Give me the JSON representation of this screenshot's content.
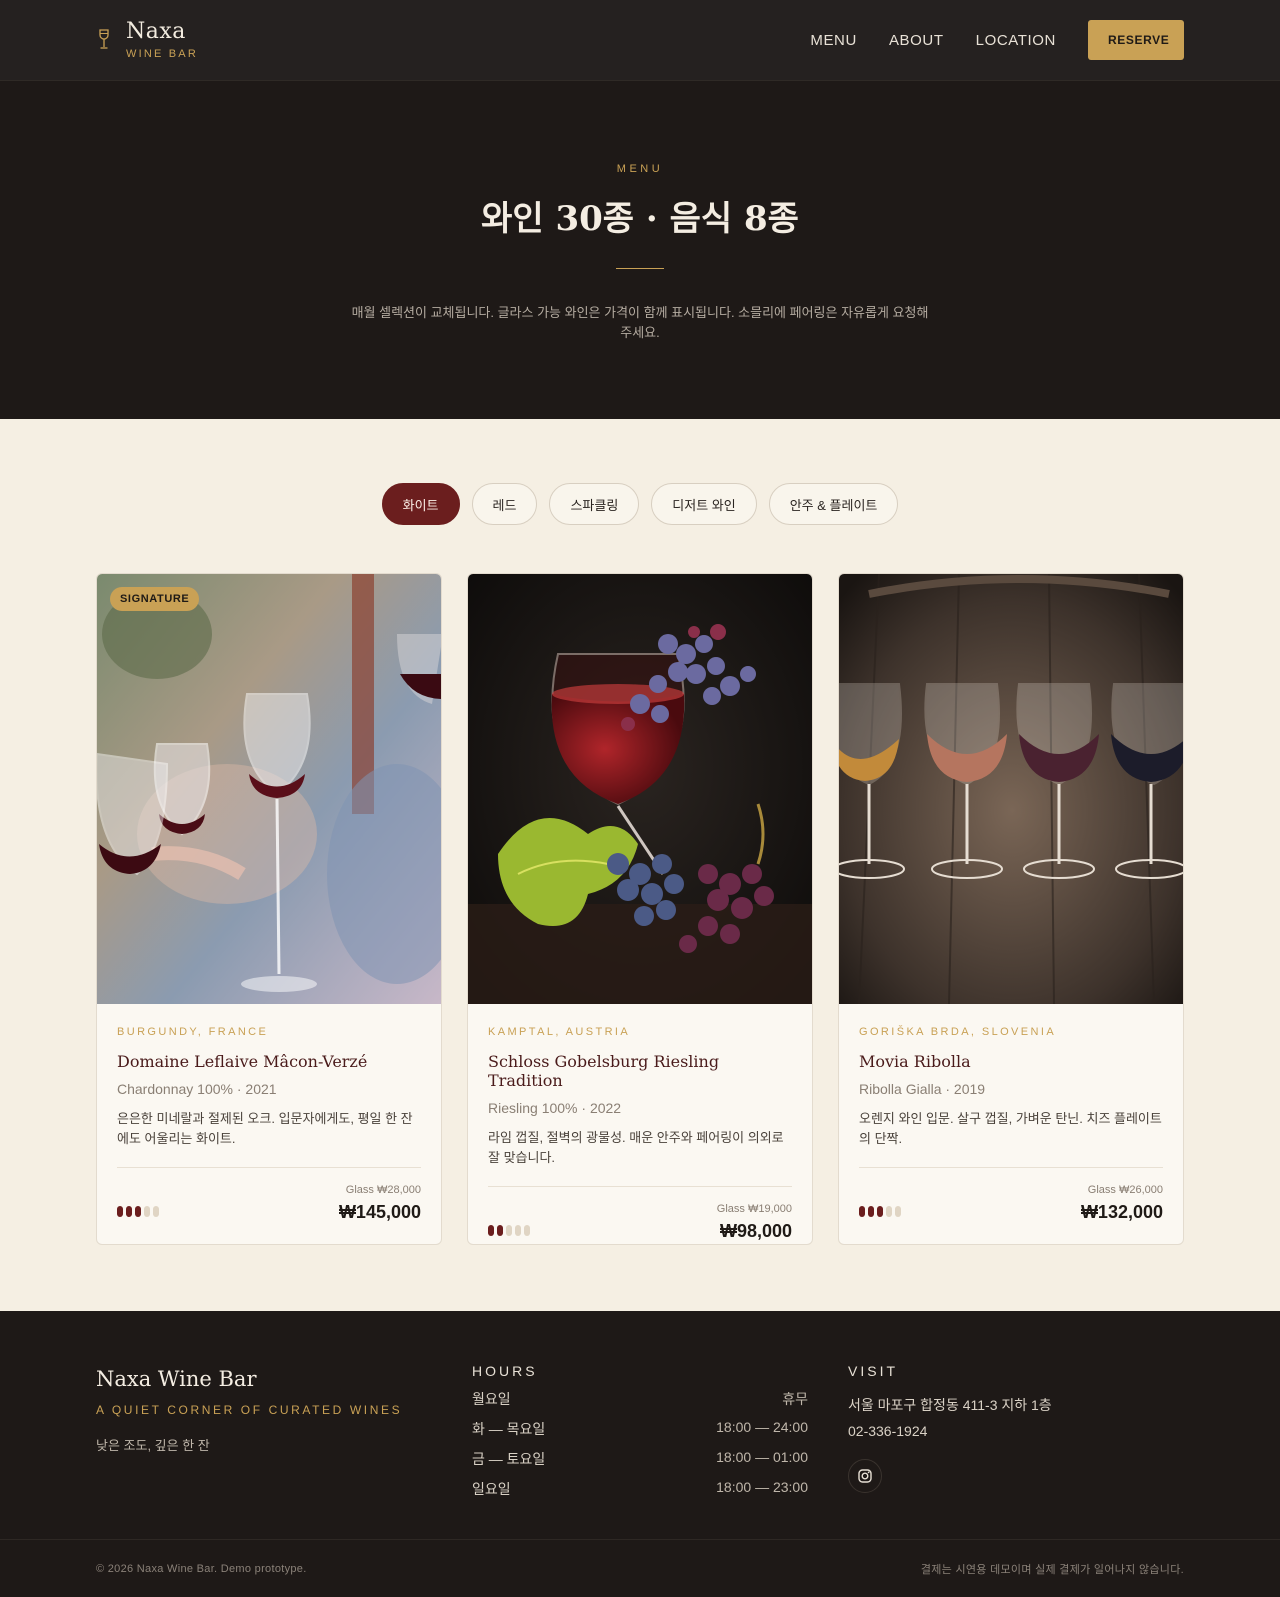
{
  "header": {
    "brand_name": "Naxa",
    "brand_sub": "WINE BAR",
    "nav": [
      "MENU",
      "ABOUT",
      "LOCATION"
    ],
    "reserve": "RESERVE"
  },
  "hero": {
    "eyebrow": "MENU",
    "title": "와인 30종 · 음식 8종",
    "description": "매월 셀렉션이 교체됩니다. 글라스 가능 와인은 가격이 함께 표시됩니다. 소믈리에 페어링은 자유롭게 요청해 주세요."
  },
  "tabs": [
    {
      "label": "화이트",
      "active": true
    },
    {
      "label": "레드",
      "active": false
    },
    {
      "label": "스파클링",
      "active": false
    },
    {
      "label": "디저트 와인",
      "active": false
    },
    {
      "label": "안주 & 플레이트",
      "active": false
    }
  ],
  "cards": [
    {
      "badge": "SIGNATURE",
      "region": "BURGUNDY, FRANCE",
      "name": "Domaine Leflaive Mâcon-Verzé",
      "grape": "Chardonnay 100% · 2021",
      "desc": "은은한 미네랄과 절제된 오크. 입문자에게도, 평일 한 잔에도 어울리는 화이트.",
      "body_level": 3,
      "body_max": 5,
      "glass": "Glass ₩28,000",
      "bottle": "₩145,000"
    },
    {
      "badge": "",
      "region": "KAMPTAL, AUSTRIA",
      "name": "Schloss Gobelsburg Riesling Tradition",
      "grape": "Riesling 100% · 2022",
      "desc": "라임 껍질, 절벽의 광물성. 매운 안주와 페어링이 의외로 잘 맞습니다.",
      "body_level": 2,
      "body_max": 5,
      "glass": "Glass ₩19,000",
      "bottle": "₩98,000"
    },
    {
      "badge": "",
      "region": "GORIŠKA BRDA, SLOVENIA",
      "name": "Movia Ribolla",
      "grape": "Ribolla Gialla · 2019",
      "desc": "오렌지 와인 입문. 살구 껍질, 가벼운 탄닌. 치즈 플레이트의 단짝.",
      "body_level": 3,
      "body_max": 5,
      "glass": "Glass ₩26,000",
      "bottle": "₩132,000"
    }
  ],
  "footer": {
    "brand": "Naxa Wine Bar",
    "tagline": "A QUIET CORNER OF CURATED WINES",
    "motto": "낮은 조도, 깊은 한 잔",
    "hours_title": "HOURS",
    "hours": [
      {
        "day": "월요일",
        "time": "휴무"
      },
      {
        "day": "화 — 목요일",
        "time": "18:00 — 24:00"
      },
      {
        "day": "금 — 토요일",
        "time": "18:00 — 01:00"
      },
      {
        "day": "일요일",
        "time": "18:00 — 23:00"
      }
    ],
    "visit_title": "VISIT",
    "address": "서울 마포구 합정동 411-3 지하 1층",
    "phone": "02-336-1924",
    "copyright": "© 2026 Naxa Wine Bar. Demo prototype.",
    "note": "결제는 시연용 데모이며 실제 결제가 일어나지 않습니다."
  },
  "colors": {
    "accent_gold": "#c9a155",
    "wine_red": "#6b1e1e",
    "dark_bg": "#1e1917",
    "cream_bg": "#f5efe3"
  },
  "icons": [
    "wine-glass-icon",
    "instagram-icon"
  ]
}
